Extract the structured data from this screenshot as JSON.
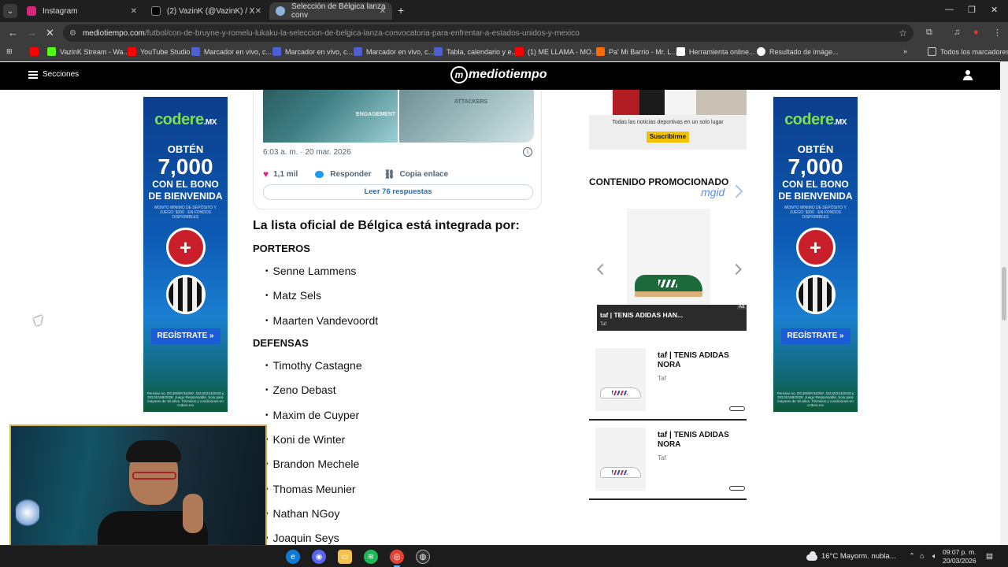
{
  "browser": {
    "tabs": [
      {
        "title": "Instagram",
        "color": "#d6287a"
      },
      {
        "title": "(2) VazinK (@VazinK) / X",
        "color": "#000000"
      },
      {
        "title": "Selección de Bélgica lanza conv",
        "color": "#8fb3d9"
      }
    ],
    "url_host": "mediotiempo.com",
    "url_path": "/futbol/con-de-bruyne-y-romelu-lukaku-la-seleccion-de-belgica-lanza-convocatoria-para-enfrentar-a-estados-unidos-y-mexico",
    "bookmarks": [
      {
        "label": "",
        "color": "#ff0000"
      },
      {
        "label": "VazinK Stream - Wa...",
        "color": "#53fc18"
      },
      {
        "label": "YouTube Studio",
        "color": "#ff0000"
      },
      {
        "label": "Marcador en vivo, c...",
        "color": "#4c5fd5"
      },
      {
        "label": "Marcador en vivo, c...",
        "color": "#4c5fd5"
      },
      {
        "label": "Marcador en vivo, c...",
        "color": "#4c5fd5"
      },
      {
        "label": "Tabla, calendario y e...",
        "color": "#4c5fd5"
      },
      {
        "label": "(1) ME LLAMA - MO...",
        "color": "#ff0000"
      },
      {
        "label": "Pa' Mi Barrio - Mr. L...",
        "color": "#ff6a00"
      },
      {
        "label": "Herramienta online...",
        "color": "#ffffff"
      },
      {
        "label": "Resultado de imáge...",
        "color": "#ffffff"
      }
    ],
    "all_bookmarks": "Todos los marcadores"
  },
  "site": {
    "sections_label": "Secciones",
    "logo": "mediotiempo",
    "logo_letter": "m"
  },
  "ads": {
    "codere": {
      "brand": "codere",
      "brand_suffix": ".MX",
      "headline": "OBTÉN",
      "amount": "7,000",
      "line1": "CON EL BONO",
      "line2": "DE BIENVENIDA",
      "fine": "MONTO MÍNIMO DE DEPÓSITO Y JUEGO: $200 · EN FONDOS DISPONIBLES",
      "cta": "REGÍSTRATE »",
      "legal": "Permiso no. DGJS/SP/442/97. DGJS/224/2018 y DGJS/168/2026. Juego Responsable. Solo para mayores de 18 años. Términos y condiciones en codere.mx"
    }
  },
  "tweet": {
    "img1_text": "ENGAGEMENT",
    "img2_text": "ATTACKERS",
    "time": "6:03 a. m. · 20 mar. 2026",
    "likes": "1,1 mil",
    "reply_label": "Responder",
    "copy_link_label": "Copia enlace",
    "read_replies": "Leer 76 respuestas"
  },
  "article": {
    "heading": "La lista oficial de Bélgica está integrada por:",
    "sections": [
      {
        "title": "PORTEROS",
        "players": [
          "Senne Lammens",
          "Matz Sels",
          "Maarten Vandevoordt"
        ]
      },
      {
        "title": "DEFENSAS",
        "players": [
          "Timothy Castagne",
          "Zeno Debast",
          "Maxim de Cuyper",
          "Koni de Winter",
          "Brandon Mechele",
          "Thomas Meunier",
          "Nathan NGoy",
          "Joaquin Seys"
        ]
      }
    ]
  },
  "sidebar": {
    "newsletter_text": "Todas las noticias deportivas en un solo lugar",
    "subscribe": "Suscribirme",
    "promo_title": "CONTENIDO PROMOCIONADO",
    "mgid": "mgid",
    "carousel_title": "taf | TENIS ADIDAS HAN...",
    "carousel_source": "Taf",
    "ad_badge": "Ad",
    "items": [
      {
        "title": "taf | TENIS ADIDAS NORA",
        "source": "Taf"
      },
      {
        "title": "taf | TENIS ADIDAS NORA",
        "source": "Taf"
      }
    ]
  },
  "taskbar": {
    "weather": "16°C  Mayorm. nubla...",
    "time": "09:07 p. m.",
    "date": "20/03/2026"
  }
}
